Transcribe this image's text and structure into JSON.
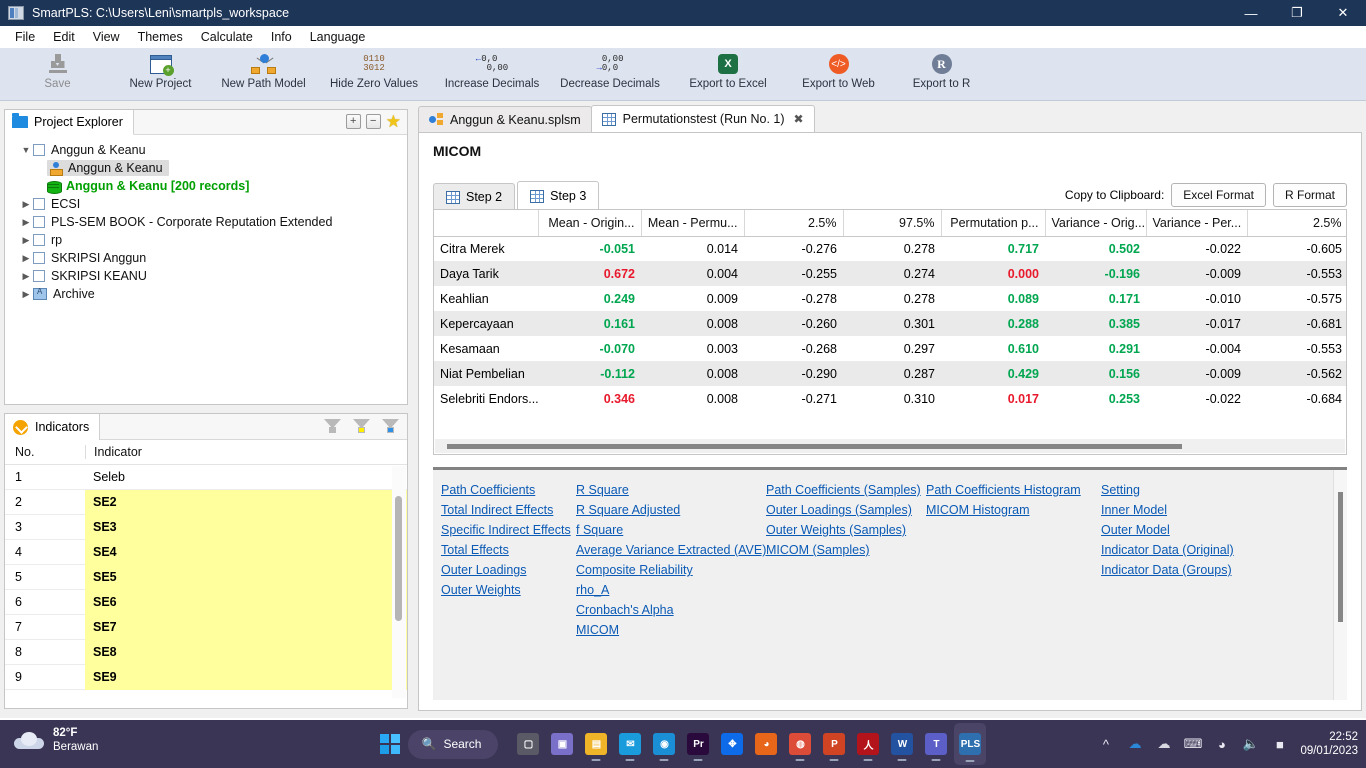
{
  "window": {
    "title": "SmartPLS: C:\\Users\\Leni\\smartpls_workspace",
    "app_icon": "smartpls-icon",
    "minimize": "—",
    "maximize": "❐",
    "close": "✕"
  },
  "menubar": {
    "items": [
      "File",
      "Edit",
      "View",
      "Themes",
      "Calculate",
      "Info",
      "Language"
    ]
  },
  "toolbar": {
    "buttons": [
      {
        "label": "Save",
        "icon": "save-icon",
        "disabled": true
      },
      {
        "label": "New Project",
        "icon": "new-project-icon",
        "disabled": false
      },
      {
        "label": "New Path Model",
        "icon": "path-model-icon",
        "disabled": false
      },
      {
        "label": "Hide Zero Values",
        "icon": "binary-icon",
        "disabled": false
      },
      {
        "label": "Increase Decimals",
        "icon": "increase-decimals-icon",
        "disabled": false
      },
      {
        "label": "Decrease Decimals",
        "icon": "decrease-decimals-icon",
        "disabled": false
      },
      {
        "label": "Export to Excel",
        "icon": "excel-icon",
        "disabled": false
      },
      {
        "label": "Export to Web",
        "icon": "web-icon",
        "disabled": false
      },
      {
        "label": "Export to R",
        "icon": "r-icon",
        "disabled": false
      }
    ]
  },
  "project_explorer": {
    "tab_label": "Project Explorer",
    "actions": {
      "expand": "+",
      "collapse": "−",
      "favorite": "★"
    },
    "tree": [
      {
        "label": "Anggun & Keanu",
        "type": "project",
        "expanded": true,
        "indent": 0
      },
      {
        "label": "Anggun & Keanu",
        "type": "model",
        "selected": true,
        "indent": 1
      },
      {
        "label": "Anggun & Keanu [200 records]",
        "type": "data",
        "indent": 1
      },
      {
        "label": "ECSI",
        "type": "project",
        "expanded": false,
        "indent": 0
      },
      {
        "label": "PLS-SEM BOOK - Corporate Reputation Extended",
        "type": "project",
        "expanded": false,
        "indent": 0
      },
      {
        "label": "rp",
        "type": "project",
        "expanded": false,
        "indent": 0
      },
      {
        "label": "SKRIPSI Anggun",
        "type": "project",
        "expanded": false,
        "indent": 0
      },
      {
        "label": "SKRIPSI KEANU",
        "type": "project",
        "expanded": false,
        "indent": 0
      },
      {
        "label": "Archive",
        "type": "archive",
        "expanded": false,
        "indent": 0
      }
    ]
  },
  "indicators": {
    "tab_label": "Indicators",
    "filters": [
      "filter-grey-icon",
      "filter-yellow-icon",
      "filter-blue-icon"
    ],
    "columns": [
      "No.",
      "Indicator"
    ],
    "rows": [
      {
        "no": "1",
        "indicator": "Seleb",
        "highlight": false
      },
      {
        "no": "2",
        "indicator": "SE2",
        "highlight": true
      },
      {
        "no": "3",
        "indicator": "SE3",
        "highlight": true
      },
      {
        "no": "4",
        "indicator": "SE4",
        "highlight": true
      },
      {
        "no": "5",
        "indicator": "SE5",
        "highlight": true
      },
      {
        "no": "6",
        "indicator": "SE6",
        "highlight": true
      },
      {
        "no": "7",
        "indicator": "SE7",
        "highlight": true
      },
      {
        "no": "8",
        "indicator": "SE8",
        "highlight": true
      },
      {
        "no": "9",
        "indicator": "SE9",
        "highlight": true
      }
    ]
  },
  "editor": {
    "tabs": [
      {
        "label": "Anggun & Keanu.splsm",
        "icon": "path-model-tab-icon",
        "active": false,
        "closable": false
      },
      {
        "label": "Permutationstest (Run No. 1)",
        "icon": "results-grid-icon",
        "active": true,
        "closable": true,
        "close_glyph": "✖"
      }
    ],
    "page_title": "MICOM",
    "step_tabs": [
      {
        "label": "Step 2",
        "active": false
      },
      {
        "label": "Step 3",
        "active": true
      }
    ],
    "clipboard": {
      "label": "Copy to Clipboard:",
      "buttons": [
        "Excel Format",
        "R Format"
      ]
    }
  },
  "table": {
    "columns": [
      "",
      "Mean - Origin...",
      "Mean - Permu...",
      "2.5%",
      "97.5%",
      "Permutation p...",
      "Variance - Orig...",
      "Variance - Per...",
      "2.5%"
    ],
    "rows": [
      {
        "name": "Citra Merek",
        "cells": [
          {
            "v": "-0.051",
            "c": "green"
          },
          {
            "v": "0.014",
            "c": "plain"
          },
          {
            "v": "-0.276",
            "c": "plain"
          },
          {
            "v": "0.278",
            "c": "plain"
          },
          {
            "v": "0.717",
            "c": "green"
          },
          {
            "v": "0.502",
            "c": "green"
          },
          {
            "v": "-0.022",
            "c": "plain"
          },
          {
            "v": "-0.605",
            "c": "plain"
          }
        ]
      },
      {
        "name": "Daya Tarik",
        "cells": [
          {
            "v": "0.672",
            "c": "red"
          },
          {
            "v": "0.004",
            "c": "plain"
          },
          {
            "v": "-0.255",
            "c": "plain"
          },
          {
            "v": "0.274",
            "c": "plain"
          },
          {
            "v": "0.000",
            "c": "red"
          },
          {
            "v": "-0.196",
            "c": "green"
          },
          {
            "v": "-0.009",
            "c": "plain"
          },
          {
            "v": "-0.553",
            "c": "plain"
          }
        ]
      },
      {
        "name": "Keahlian",
        "cells": [
          {
            "v": "0.249",
            "c": "green"
          },
          {
            "v": "0.009",
            "c": "plain"
          },
          {
            "v": "-0.278",
            "c": "plain"
          },
          {
            "v": "0.278",
            "c": "plain"
          },
          {
            "v": "0.089",
            "c": "green"
          },
          {
            "v": "0.171",
            "c": "green"
          },
          {
            "v": "-0.010",
            "c": "plain"
          },
          {
            "v": "-0.575",
            "c": "plain"
          }
        ]
      },
      {
        "name": "Kepercayaan",
        "cells": [
          {
            "v": "0.161",
            "c": "green"
          },
          {
            "v": "0.008",
            "c": "plain"
          },
          {
            "v": "-0.260",
            "c": "plain"
          },
          {
            "v": "0.301",
            "c": "plain"
          },
          {
            "v": "0.288",
            "c": "green"
          },
          {
            "v": "0.385",
            "c": "green"
          },
          {
            "v": "-0.017",
            "c": "plain"
          },
          {
            "v": "-0.681",
            "c": "plain"
          }
        ]
      },
      {
        "name": "Kesamaan",
        "cells": [
          {
            "v": "-0.070",
            "c": "green"
          },
          {
            "v": "0.003",
            "c": "plain"
          },
          {
            "v": "-0.268",
            "c": "plain"
          },
          {
            "v": "0.297",
            "c": "plain"
          },
          {
            "v": "0.610",
            "c": "green"
          },
          {
            "v": "0.291",
            "c": "green"
          },
          {
            "v": "-0.004",
            "c": "plain"
          },
          {
            "v": "-0.553",
            "c": "plain"
          }
        ]
      },
      {
        "name": "Niat Pembelian",
        "cells": [
          {
            "v": "-0.112",
            "c": "green"
          },
          {
            "v": "0.008",
            "c": "plain"
          },
          {
            "v": "-0.290",
            "c": "plain"
          },
          {
            "v": "0.287",
            "c": "plain"
          },
          {
            "v": "0.429",
            "c": "green"
          },
          {
            "v": "0.156",
            "c": "green"
          },
          {
            "v": "-0.009",
            "c": "plain"
          },
          {
            "v": "-0.562",
            "c": "plain"
          }
        ]
      },
      {
        "name": "Selebriti Endors...",
        "cells": [
          {
            "v": "0.346",
            "c": "red"
          },
          {
            "v": "0.008",
            "c": "plain"
          },
          {
            "v": "-0.271",
            "c": "plain"
          },
          {
            "v": "0.310",
            "c": "plain"
          },
          {
            "v": "0.017",
            "c": "red"
          },
          {
            "v": "0.253",
            "c": "green"
          },
          {
            "v": "-0.022",
            "c": "plain"
          },
          {
            "v": "-0.684",
            "c": "plain"
          }
        ]
      }
    ]
  },
  "links": {
    "col1": [
      "Path Coefficients",
      "Total Indirect Effects",
      "Specific Indirect Effects",
      "Total Effects",
      "Outer Loadings",
      "Outer Weights"
    ],
    "col2": [
      "R Square",
      "R Square Adjusted",
      "f Square",
      "Average Variance Extracted (AVE)",
      "Composite Reliability",
      "rho_A",
      "Cronbach's Alpha",
      "MICOM"
    ],
    "col3": [
      "Path Coefficients (Samples)",
      "Outer Loadings (Samples)",
      "Outer Weights (Samples)",
      "MICOM (Samples)"
    ],
    "col4": [
      "Path Coefficients Histogram",
      "MICOM Histogram"
    ],
    "col5": [
      "Setting",
      "Inner Model",
      "Outer Model",
      "Indicator Data (Original)",
      "Indicator Data (Groups)"
    ]
  },
  "taskbar": {
    "weather": {
      "temperature": "82°F",
      "condition": "Berawan",
      "icon": "cloud-icon"
    },
    "start": "windows-start-icon",
    "search": {
      "label": "Search",
      "icon": "search-icon"
    },
    "apps": [
      {
        "name": "task-view-icon",
        "glyph": "▢",
        "color": "#5a5a66",
        "running": false
      },
      {
        "name": "chat-icon",
        "glyph": "▣",
        "color": "#7a6fc9",
        "running": false
      },
      {
        "name": "file-explorer-icon",
        "glyph": "▤",
        "color": "#f0b429",
        "running": true
      },
      {
        "name": "mail-icon",
        "glyph": "✉",
        "color": "#1a9bdc",
        "running": true
      },
      {
        "name": "edge-icon",
        "glyph": "◉",
        "color": "#1b8fd6",
        "running": true
      },
      {
        "name": "premiere-pro-icon",
        "glyph": "Pr",
        "color": "#2a0a3d",
        "running": true
      },
      {
        "name": "dropbox-icon",
        "glyph": "✥",
        "color": "#0d6ae8",
        "running": false
      },
      {
        "name": "firefox-icon",
        "glyph": "◕",
        "color": "#e8661a",
        "running": false
      },
      {
        "name": "chrome-icon",
        "glyph": "◍",
        "color": "#dd4b39",
        "running": true
      },
      {
        "name": "powerpoint-icon",
        "glyph": "P",
        "color": "#d04423",
        "running": true
      },
      {
        "name": "acrobat-reader-icon",
        "glyph": "人",
        "color": "#b3131a",
        "running": true
      },
      {
        "name": "word-icon",
        "glyph": "W",
        "color": "#2352a0",
        "running": true
      },
      {
        "name": "teams-icon",
        "glyph": "T",
        "color": "#5b5fc7",
        "running": true
      },
      {
        "name": "smartpls-icon",
        "glyph": "PLS",
        "color": "#2e6fb0",
        "running": true
      }
    ],
    "tray": [
      "chevron-up-icon",
      "onedrive-blue-icon",
      "onedrive-white-icon",
      "keyboard-icon",
      "wifi-icon",
      "volume-icon",
      "battery-icon"
    ],
    "clock": {
      "time": "22:52",
      "date": "09/01/2023"
    }
  }
}
